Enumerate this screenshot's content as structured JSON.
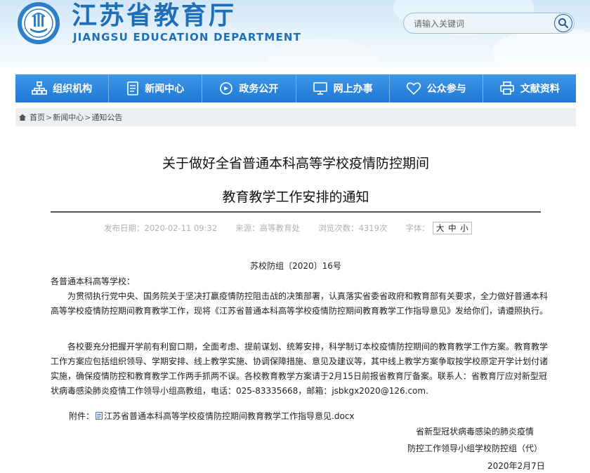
{
  "header": {
    "title_cn": "江苏省教育厅",
    "title_en": "JIANGSU EDUCATION DEPARTMENT",
    "logo_icon": "jiangsu-education-emblem"
  },
  "search": {
    "placeholder": "请输入关键词",
    "button_icon": "search-icon"
  },
  "nav": {
    "items": [
      {
        "label": "组织机构",
        "icon": "org-chart-icon"
      },
      {
        "label": "新闻中心",
        "icon": "document-icon"
      },
      {
        "label": "政务公开",
        "icon": "government-icon"
      },
      {
        "label": "网上办事",
        "icon": "monitor-icon"
      },
      {
        "label": "公众参与",
        "icon": "heart-icon"
      },
      {
        "label": "文献资料",
        "icon": "printer-icon"
      }
    ]
  },
  "breadcrumb": {
    "items": [
      "首页",
      "新闻中心",
      "通知公告"
    ],
    "separator": ">"
  },
  "article": {
    "title_line1": "关于做好全省普通本科高等学校疫情防控期间",
    "title_line2": "教育教学工作安排的通知",
    "meta": {
      "date_label": "发布日期：",
      "date": "2020-02-11 09:32",
      "source_label": "来源：",
      "source": "高等教育处",
      "views_label": "浏览次数：",
      "views": "4319次",
      "fontsize_label": "字体：",
      "fontsize_options": [
        "大",
        "中",
        "小"
      ]
    },
    "doc_number": "苏校防组〔2020〕16号",
    "salutation": "各普通本科高等学校：",
    "paragraph1": "为贯彻执行党中央、国务院关于坚决打赢疫情防控阻击战的决策部署，认真落实省委省政府和教育部有关要求，全力做好普通本科高等学校疫情防控期间教育教学工作，现将《江苏省普通本科高等学校疫情防控期间教育教学工作指导意见》发给你们，请遵照执行。",
    "paragraph2": "各校要充分把握开学前有利窗口期，全面考虑、提前谋划、统筹安排，科学制订本校疫情防控期间的教育教学工作方案。教育教学工作方案应包括组织领导、学期安排、线上教学实施、协调保障措施、意见及建议等，其中线上教学方案争取按学校原定开学计划付诸实施，确保疫情防控和教育教学工作两手抓两不误。各校教育教学方案请于2月15日前报省教育厅备案。联系人：省教育厅应对新型冠状病毒感染肺炎疫情工作领导小组高教组，电话：025-83335668，邮箱：jsbkgx2020@126.com.",
    "attachment_label": "附件：",
    "attachment_name": "江苏省普通本科高等学校疫情防控期间教育教学工作指导意见.docx",
    "signature_line1": "省新型冠状病毒感染的肺炎疫情",
    "signature_line2": "防控工作领导小组学校防控组（代）",
    "signature_date": "2020年2月7日"
  },
  "colors": {
    "brand_blue": "#1f6fb8",
    "nav_blue": "#2a86dc",
    "meta_gray": "#b0b0b0"
  }
}
